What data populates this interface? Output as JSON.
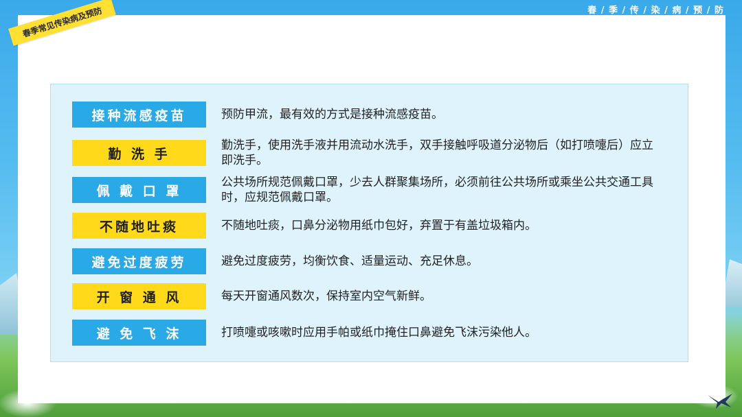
{
  "header": {
    "title": "春 / 季 / 传 / 染 / 病 / 预 / 防"
  },
  "ribbon": {
    "label": "春季常见传染病及预防"
  },
  "rows": [
    {
      "tag": "接种流感疫苗",
      "style": "blue",
      "desc": "预防甲流，最有效的方式是接种流感疫苗。"
    },
    {
      "tag": "勤 洗 手",
      "style": "yellow",
      "desc": "勤洗手，使用洗手液并用流动水洗手，双手接触呼吸道分泌物后（如打喷嚏后）应立即洗手。"
    },
    {
      "tag": "佩 戴 口 罩",
      "style": "blue",
      "desc": "公共场所规范佩戴口罩，少去人群聚集场所，必须前往公共场所或乘坐公共交通工具时，应规范佩戴口罩。"
    },
    {
      "tag": "不随地吐痰",
      "style": "yellow",
      "desc": "不随地吐痰，口鼻分泌物用纸巾包好，弃置于有盖垃圾箱内。"
    },
    {
      "tag": "避免过度疲劳",
      "style": "blue",
      "desc": "避免过度疲劳，均衡饮食、适量运动、充足休息。"
    },
    {
      "tag": "开 窗 通 风",
      "style": "yellow",
      "desc": "每天开窗通风数次，保持室内空气新鲜。"
    },
    {
      "tag": "避 免 飞 沫",
      "style": "blue",
      "desc": "打喷嚏或咳嗽时应用手帕或纸巾掩住口鼻避免飞沫污染他人。"
    }
  ],
  "colors": {
    "blue": "#29a9e6",
    "yellow": "#ffd91a",
    "card": "#dff3fc"
  },
  "icons": {
    "bird": "swallow-icon"
  }
}
